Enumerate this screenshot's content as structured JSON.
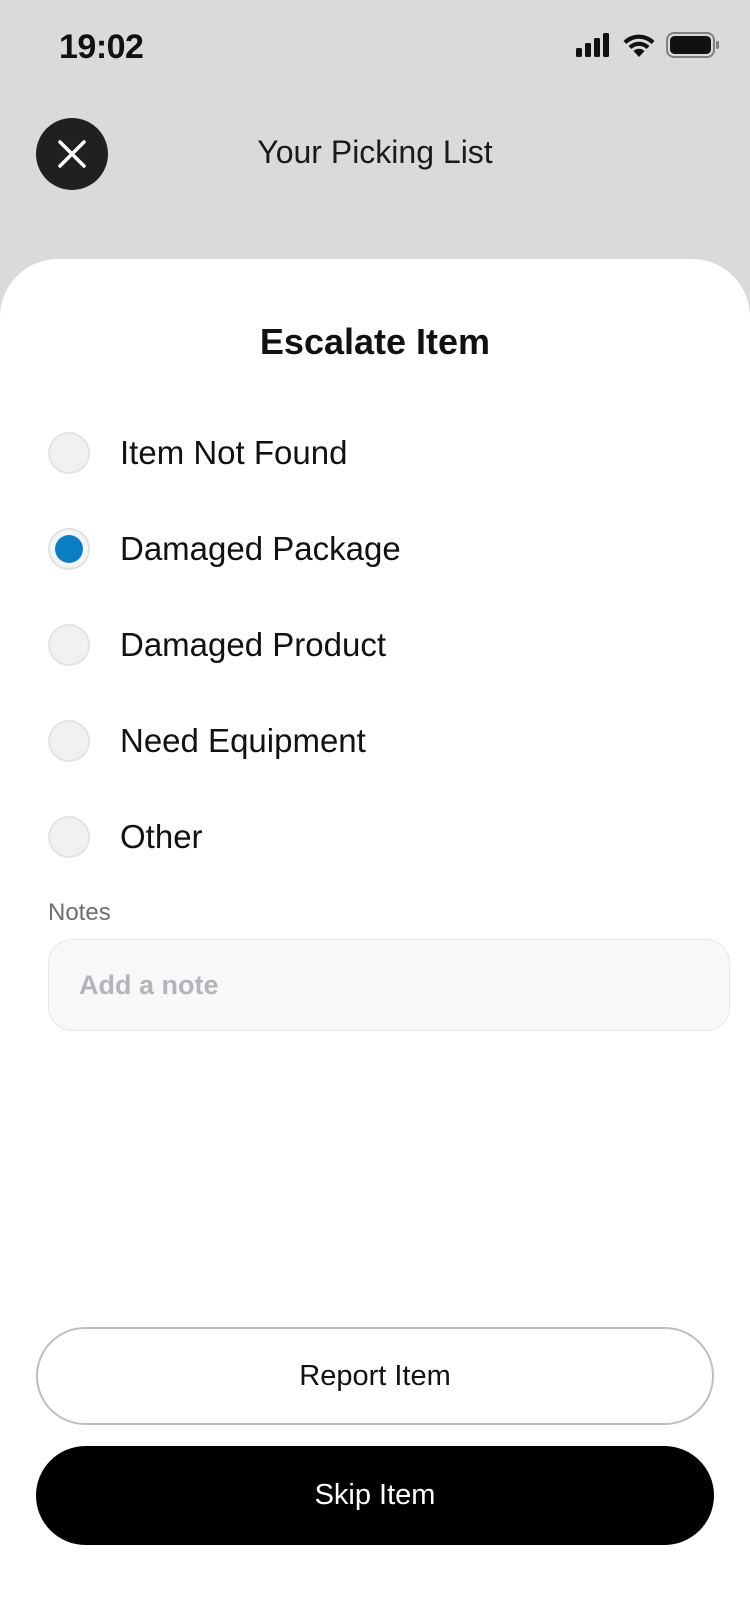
{
  "status_bar": {
    "time": "19:02",
    "icons": [
      "signal-icon",
      "wifi-icon",
      "battery-icon"
    ]
  },
  "header": {
    "title": "Your Picking List",
    "close_icon": "close-icon"
  },
  "sheet": {
    "title": "Escalate Item",
    "options": [
      {
        "label": "Item Not Found",
        "selected": false
      },
      {
        "label": "Damaged Package",
        "selected": true
      },
      {
        "label": "Damaged Product",
        "selected": false
      },
      {
        "label": "Need Equipment",
        "selected": false
      },
      {
        "label": "Other",
        "selected": false
      }
    ],
    "notes": {
      "label": "Notes",
      "placeholder": "Add a note",
      "value": ""
    },
    "report_button": "Report Item",
    "skip_button": "Skip Item"
  },
  "colors": {
    "background": "#d9dadb",
    "accent": "#0a7ec2",
    "primary_button": "#000000",
    "close_button": "#1f2022"
  }
}
